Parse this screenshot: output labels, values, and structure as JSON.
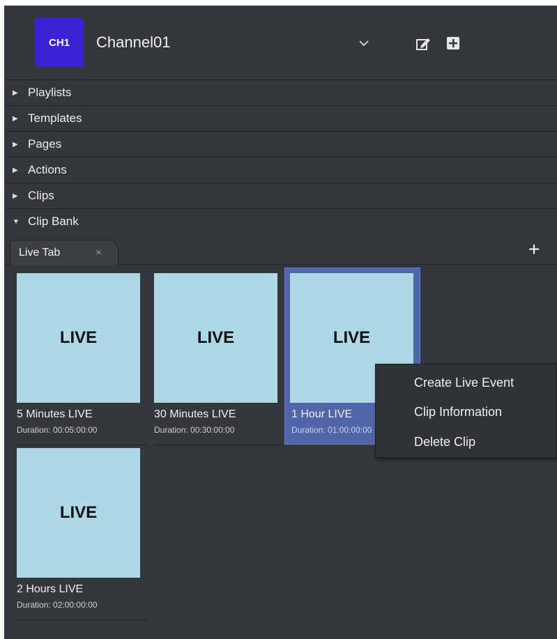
{
  "header": {
    "badge": "CH1",
    "channel_name": "Channel01"
  },
  "sections": [
    {
      "label": "Playlists",
      "expanded": false
    },
    {
      "label": "Templates",
      "expanded": false
    },
    {
      "label": "Pages",
      "expanded": false
    },
    {
      "label": "Actions",
      "expanded": false
    },
    {
      "label": "Clips",
      "expanded": false
    },
    {
      "label": "Clip Bank",
      "expanded": true
    }
  ],
  "clip_bank": {
    "tab_label": "Live Tab",
    "tab_close": "×",
    "add_tab": "+",
    "clips": [
      {
        "thumb": "LIVE",
        "name": "5 Minutes LIVE",
        "duration": "Duration: 00:05:00:00",
        "selected": false
      },
      {
        "thumb": "LIVE",
        "name": "30 Minutes LIVE",
        "duration": "Duration: 00:30:00:00",
        "selected": false
      },
      {
        "thumb": "LIVE",
        "name": "1 Hour LIVE",
        "duration": "Duration: 01:00:00:00",
        "selected": true
      },
      {
        "thumb": "LIVE",
        "name": "2 Hours LIVE",
        "duration": "Duration: 02:00:00:00",
        "selected": false
      }
    ]
  },
  "context_menu": {
    "items": [
      "Create Live Event",
      "Clip Information",
      "Delete Clip"
    ]
  },
  "colors": {
    "panel_bg": "#34373c",
    "badge_bg": "#3b22d4",
    "thumb_bg": "#aed8e6",
    "selection": "#5066a8"
  }
}
